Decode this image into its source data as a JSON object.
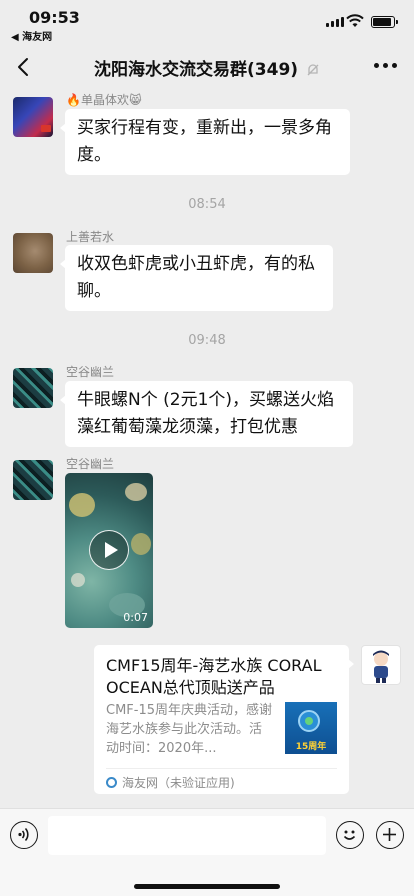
{
  "status": {
    "time": "09:53",
    "back_app": "◀ 海友网",
    "battery_level": 0.9
  },
  "nav": {
    "title": "沈阳海水交流交易群(349)",
    "back_icon": "chevron-left-icon",
    "muted_icon": "bell-off-icon",
    "more_icon": "more-dots-icon"
  },
  "messages": [
    {
      "type": "text",
      "sender": "🔥单晶体欢😸",
      "text": "买家行程有变，重新出，一景多角度。"
    },
    {
      "type": "timestamp",
      "text": "08:54"
    },
    {
      "type": "text",
      "sender": "上善若水",
      "text": "收双色虾虎或小丑虾虎，有的私聊。"
    },
    {
      "type": "timestamp",
      "text": "09:48"
    },
    {
      "type": "text",
      "sender": "空谷幽兰",
      "text": "牛眼螺N个 (2元1个)，买螺送火焰藻红葡萄藻龙须藻，打包优惠"
    },
    {
      "type": "video",
      "sender": "空谷幽兰",
      "duration": "0:07"
    },
    {
      "type": "link_card",
      "from_self": true,
      "title": "CMF15周年-海艺水族 CORAL OCEAN总代顶贴送产品",
      "description": "CMF-15周年庆典活动，感谢海艺水族参与此次活动。活动时间：2020年...",
      "thumb_caption": "15周年",
      "source": "海友网（未验证应用)"
    }
  ],
  "input_bar": {
    "voice_icon": "voice-icon",
    "emoji_icon": "emoji-icon",
    "plus_icon": "plus-icon"
  },
  "colors": {
    "background": "#ededed",
    "bubble": "#ffffff",
    "meta_text": "#888888",
    "timestamp": "#a5a5a5"
  }
}
